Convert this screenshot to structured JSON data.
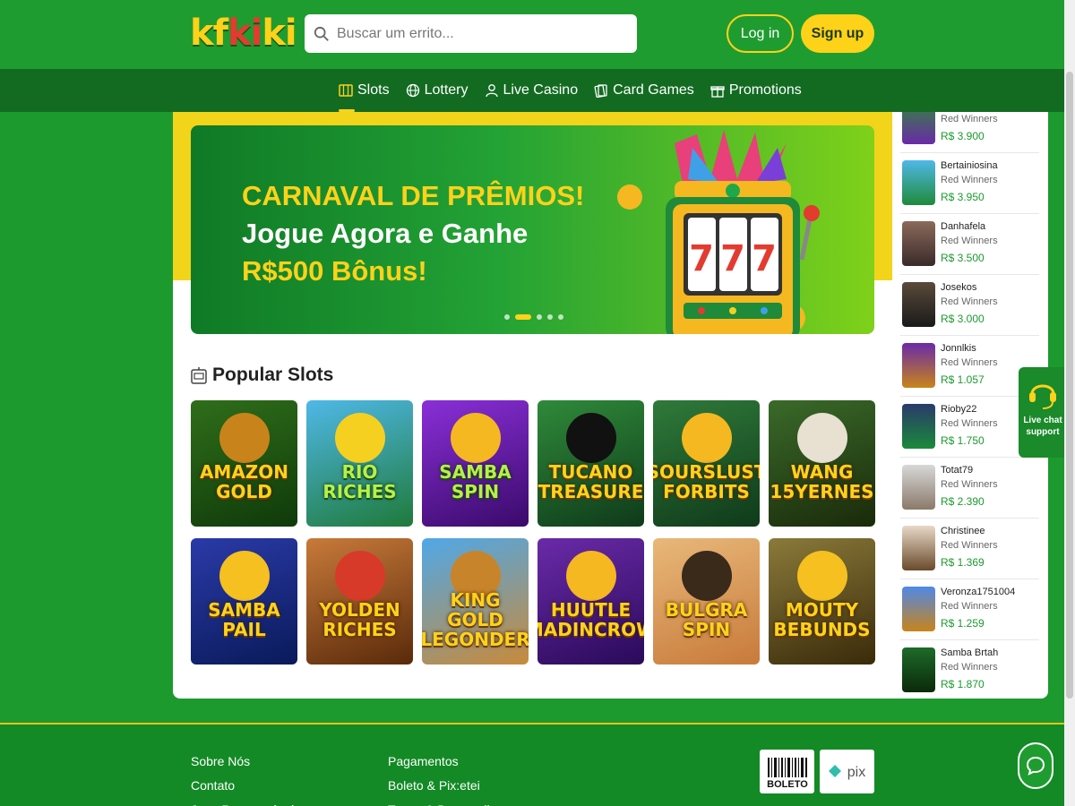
{
  "header": {
    "logo_part1": "kf",
    "logo_part2": "ki",
    "logo_part3": "ki",
    "search_placeholder": "Buscar um errito...",
    "login_label": "Log in",
    "signup_label": "Sign up"
  },
  "nav": {
    "items": [
      {
        "label": "Slots",
        "icon": "slot-icon"
      },
      {
        "label": "Lottery",
        "icon": "globe-icon"
      },
      {
        "label": "Live Casino",
        "icon": "dealer-icon"
      },
      {
        "label": "Card Games",
        "icon": "cards-icon"
      },
      {
        "label": "Promotions",
        "icon": "gift-icon"
      }
    ],
    "active_index": 0
  },
  "hero": {
    "line1": "CARNAVAL DE PRÊMIOS!",
    "line2": "Jogue Agora e Ganhe",
    "line3": "R$500 Bônus!",
    "slot_digits": [
      "7",
      "7",
      "7"
    ],
    "carousel_dots": 5,
    "carousel_active": 1
  },
  "popular": {
    "title": "Popular Slots",
    "games": [
      {
        "line1": "AMAZON",
        "line2": "GOLD",
        "style": "yellow"
      },
      {
        "line1": "RIO",
        "line2": "RICHES",
        "style": "green"
      },
      {
        "line1": "SAMBA",
        "line2": "SPIN",
        "style": "green"
      },
      {
        "line1": "TUCANO",
        "line2": "TREASURE",
        "style": "yellow"
      },
      {
        "line1": "SOURSLUST",
        "line2": "FORBITS",
        "style": "yellow"
      },
      {
        "line1": "WANG",
        "line2": "15YERNES",
        "style": "yellow"
      },
      {
        "line1": "SAMBA",
        "line2": "PAIL",
        "style": "yellow"
      },
      {
        "line1": "YOLDEN",
        "line2": "RICHES",
        "style": "yellow"
      },
      {
        "line1": "KING GOLD",
        "line2": "LEGONDER",
        "style": "yellow"
      },
      {
        "line1": "HUUTLE",
        "line2": "MADINCROW",
        "style": "yellow"
      },
      {
        "line1": "BULGRA",
        "line2": "SPIN",
        "style": "yellow"
      },
      {
        "line1": "MOUTY",
        "line2": "BEBUNDS",
        "style": "yellow"
      }
    ]
  },
  "winners": {
    "items": [
      {
        "name": "",
        "sub": "Red Winners",
        "amount": "R$ 3.900"
      },
      {
        "name": "Bertainiosina",
        "sub": "Red Winners",
        "amount": "R$ 3.950"
      },
      {
        "name": "Danhafela",
        "sub": "Red Winners",
        "amount": "R$ 3.500"
      },
      {
        "name": "Josekos",
        "sub": "Red Winners",
        "amount": "R$ 3.000"
      },
      {
        "name": "Jonnlkis",
        "sub": "Red Winners",
        "amount": "R$ 1.057"
      },
      {
        "name": "Rioby22",
        "sub": "Red Winners",
        "amount": "R$ 1.750"
      },
      {
        "name": "Totat79",
        "sub": "Red Winners",
        "amount": "R$ 2.390"
      },
      {
        "name": "Christinee",
        "sub": "Red Winners",
        "amount": "R$ 1.369"
      },
      {
        "name": "Veronza1751004",
        "sub": "Red Winners",
        "amount": "R$ 1.259"
      },
      {
        "name": "Samba Brtah",
        "sub": "Red Winners",
        "amount": "R$ 1.870"
      }
    ]
  },
  "live_chat": {
    "line1": "Live chat",
    "line2": "support"
  },
  "footer": {
    "col1": [
      "Sobre Nós",
      "Contato",
      "Jogo Responsável"
    ],
    "col2": [
      "Pagamentos",
      "Boleto & Pix:etei",
      "Terms & Desgrveil"
    ],
    "payment_badges": [
      "BOLETO",
      "pix"
    ]
  },
  "colors": {
    "brand_green": "#1f9c30",
    "nav_green": "#136b22",
    "accent_yellow": "#ffd21a",
    "amount_green": "#1c9a2e"
  }
}
